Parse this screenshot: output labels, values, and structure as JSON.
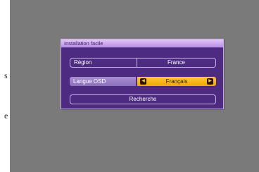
{
  "margin_glyphs": [
    "s",
    "e"
  ],
  "dialog": {
    "title": "Installation facile",
    "rows": {
      "region": {
        "label": "Région",
        "value": "France"
      },
      "language": {
        "label": "Langue OSD",
        "value": "Français"
      },
      "search": {
        "label": "Recherche"
      }
    }
  },
  "icons": {
    "left_arrow": "◀",
    "right_arrow": "▶"
  },
  "colors": {
    "background": "#7a7a7a",
    "dialog_bg": "#4c2b80",
    "titlebar": "#c9a3ee",
    "selected_value": "#f7b51c",
    "selected_label": "#9a7fc8"
  }
}
